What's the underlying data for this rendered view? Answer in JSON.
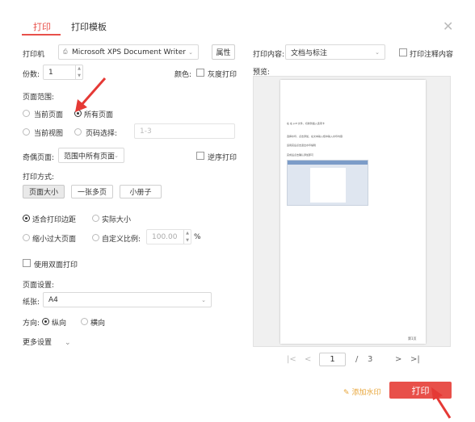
{
  "tabs": [
    {
      "label": "打印"
    },
    {
      "label": "打印模板"
    }
  ],
  "printer": {
    "label": "打印机",
    "value": "Microsoft XPS Document Writer",
    "properties": "属性"
  },
  "copies": {
    "label": "份数:",
    "value": "1"
  },
  "color": {
    "label": "颜色:",
    "grayscale": "灰度打印"
  },
  "range": {
    "title": "页面范围:",
    "current_page": "当前页面",
    "all_pages": "所有页面",
    "current_view": "当前视图",
    "page_select": "页码选择:",
    "page_select_placeholder": "1-3"
  },
  "odd_even": {
    "label": "奇偶页面:",
    "value": "范围中所有页面",
    "reverse": "逆序打印"
  },
  "method": {
    "title": "打印方式:",
    "options": [
      "页面大小",
      "一张多页",
      "小册子"
    ]
  },
  "fit": {
    "fit_margin": "适合打印边距",
    "actual_size": "实际大小",
    "shrink": "缩小过大页面",
    "custom_scale": "自定义比例:",
    "scale_value": "100.00",
    "percent": "%"
  },
  "duplex": {
    "label": "使用双面打印"
  },
  "page_setup": {
    "title": "页面设置:",
    "paper_label": "纸张:",
    "paper_value": "A4"
  },
  "orientation": {
    "label": "方向:",
    "portrait": "纵向",
    "landscape": "横向"
  },
  "more": {
    "label": "更多设置"
  },
  "content": {
    "label": "打印内容:",
    "value": "文档与标注",
    "annotation": "打印注释内容"
  },
  "preview": {
    "label": "预览:",
    "lines": [
      "在 在 pdf 文件，切换到插入选项卡",
      "选择水印，点击添加，在文本输入框中输入水印内容",
      "运用完后点击退出水印编辑",
      "完成后点击确认添加即可"
    ],
    "page_no": "第1页"
  },
  "pager": {
    "first": "|<",
    "prev": "<",
    "current": "1",
    "sep": "/",
    "total": "3",
    "next": ">",
    "last": ">|"
  },
  "footer": {
    "watermark": "添加水印",
    "print": "打印"
  },
  "icons": {
    "printer": "printer-icon",
    "watermark": "watermark-icon",
    "close": "close-icon"
  },
  "colors": {
    "accent": "#e8504a",
    "arrow": "#e53935",
    "watermark": "#e8a63a"
  }
}
